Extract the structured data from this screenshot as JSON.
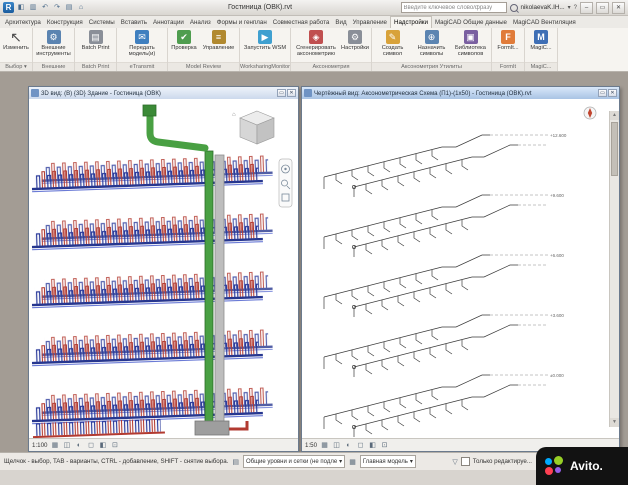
{
  "titlebar": {
    "brand": "R",
    "title": "Гостиница (ОВК).rvt",
    "search_placeholder": "Введите ключевое слово/фразу",
    "user": "nikolaevaK.IH...",
    "help": "?"
  },
  "icons": {
    "caret": "▾",
    "qat": [
      "◧",
      "▥",
      "↶",
      "↷",
      "▤",
      "⌂"
    ],
    "modify": "↖",
    "external_tools": "⚙",
    "batch_print": "▤",
    "etransmit": "✉",
    "check": "✔",
    "manage": "≡",
    "wsm": "▶",
    "axon": "◈",
    "settings": "⚙",
    "create_symbol": "✎",
    "assign_symbols": "⊕",
    "symbol_library": "▣",
    "formit": "F",
    "magicad": "M",
    "win_min": "–",
    "win_restore": "▭",
    "win_close": "✕",
    "viewbar": [
      "▦",
      "◫",
      "◐",
      "◻",
      "◧",
      "⊡"
    ],
    "scroll_up": "▲",
    "scroll_down": "▼",
    "workset": "▤",
    "options": "▦",
    "filter": "▽"
  },
  "tabs": [
    "Архитектура",
    "Конструкция",
    "Системы",
    "Вставить",
    "Аннотации",
    "Анализ",
    "Формы и генплан",
    "Совместная работа",
    "Вид",
    "Управление",
    "Надстройки",
    "MagiCAD Общие данные",
    "MagiCAD Вентиляция"
  ],
  "ribbon": {
    "groups": [
      {
        "label": "Выбор ▾",
        "buttons": [
          {
            "label": "Изменить"
          }
        ]
      },
      {
        "label": "Внешние",
        "buttons": [
          {
            "label": "Внешние инструменты"
          }
        ]
      },
      {
        "label": "Batch Print",
        "buttons": [
          {
            "label": "Batch Print"
          }
        ]
      },
      {
        "label": "eTransmit",
        "buttons": [
          {
            "label": "Передать модель(и)"
          }
        ]
      },
      {
        "label": "Model Review",
        "buttons": [
          {
            "label": "Проверка"
          },
          {
            "label": "Управление"
          }
        ]
      },
      {
        "label": "WorksharingMonitor",
        "buttons": [
          {
            "label": "Запустить WSM"
          }
        ]
      },
      {
        "label": "Аксонометрия",
        "buttons": [
          {
            "label": "Сгенерировать аксонометрию"
          },
          {
            "label": "Настройки"
          }
        ]
      },
      {
        "label": "Аксонометрия Утилиты",
        "buttons": [
          {
            "label": "Создать символ"
          },
          {
            "label": "Назначить символы"
          },
          {
            "label": "Библиотека символов"
          }
        ]
      },
      {
        "label": "FormIt",
        "buttons": [
          {
            "label": "FormIt..."
          }
        ]
      },
      {
        "label": "MagiC...",
        "buttons": [
          {
            "label": "MagiC..."
          }
        ]
      }
    ]
  },
  "left_view": {
    "title": "3D вид: (В) {3D} Здание - Гостиница (ОВК)",
    "scale": "1:100"
  },
  "right_view": {
    "title": "Чертёжный вид: Аксонометрическая Схема (П1)-(1х50) - Гостиница (ОВК).rvt",
    "scale": "1:50",
    "levels": [
      "+12.600",
      "+9.600",
      "+6.600",
      "+3.600",
      "±0.000"
    ]
  },
  "statusbar": {
    "hint": "Щелчок - выбор, TAB - варианты, CTRL - добавление, SHIFT - снятие выбора.",
    "workset_select": "Общие уровни и сетки (не подле",
    "design_option_select": "Главная модель",
    "editable_only_label": "Только редактируе..."
  },
  "watermark": {
    "text": "Avito."
  }
}
